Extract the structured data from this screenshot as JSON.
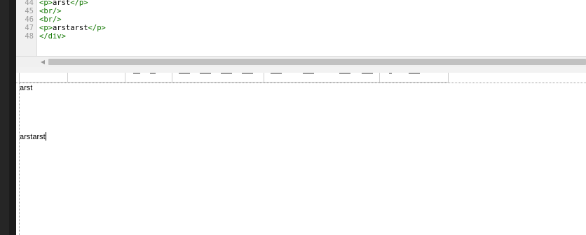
{
  "code_editor": {
    "lines": [
      {
        "num": "44",
        "parts": [
          {
            "t": "tag",
            "v": "<p>"
          },
          {
            "t": "txt",
            "v": "arst"
          },
          {
            "t": "tag",
            "v": "</p>"
          }
        ]
      },
      {
        "num": "45",
        "parts": [
          {
            "t": "tag",
            "v": "<br/>"
          }
        ]
      },
      {
        "num": "46",
        "parts": [
          {
            "t": "tag",
            "v": "<br/>"
          }
        ]
      },
      {
        "num": "47",
        "parts": [
          {
            "t": "tag",
            "v": "<p>"
          },
          {
            "t": "txt",
            "v": "arstarst"
          },
          {
            "t": "tag",
            "v": "</p>"
          }
        ]
      },
      {
        "num": "48",
        "parts": [
          {
            "t": "tag",
            "v": "</div>"
          }
        ]
      }
    ]
  },
  "scrollbar": {
    "left_arrow": "◀"
  },
  "wysiwyg": {
    "paragraph_1": "arst",
    "paragraph_2": "arstarst"
  },
  "colors": {
    "tag": "#117700",
    "text": "#000000",
    "line_number": "#999999"
  }
}
